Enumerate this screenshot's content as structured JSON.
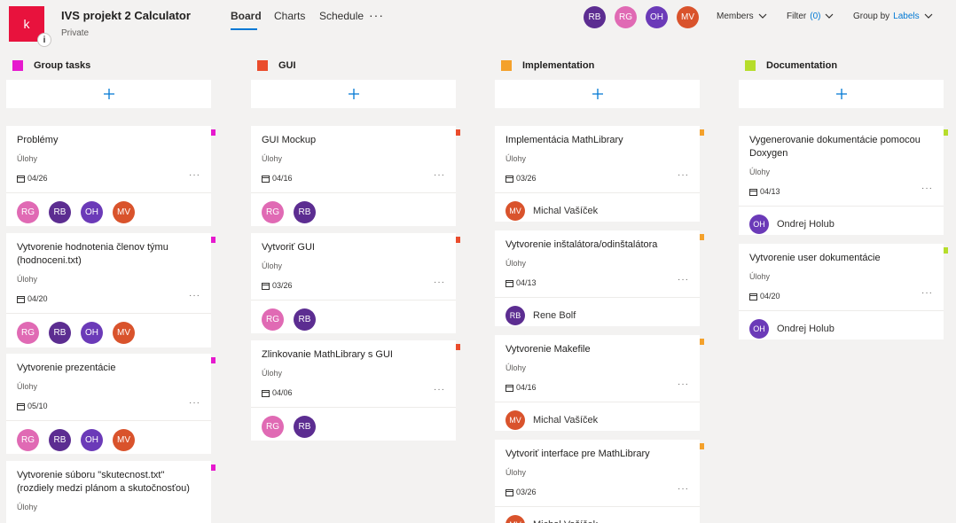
{
  "header": {
    "logo_letter": "k",
    "logo_badge": "i",
    "plan_title": "IVS projekt 2 Calculator",
    "plan_subtitle": "Private",
    "tabs": [
      {
        "label": "Board",
        "active": true
      },
      {
        "label": "Charts"
      },
      {
        "label": "Schedule"
      }
    ],
    "more_label": "···",
    "avatars": [
      {
        "initials": "RB",
        "color": "#5c2d91"
      },
      {
        "initials": "RG",
        "color": "#e06ab4"
      },
      {
        "initials": "OH",
        "color": "#6b3ab8"
      },
      {
        "initials": "MV",
        "color": "#d9532c"
      }
    ],
    "members_label": "Members",
    "filter_label": "Filter",
    "filter_count": "(0)",
    "group_by_label": "Group by",
    "group_by_value": "Labels"
  },
  "colors": {
    "accent": "#0078d4",
    "RB": "#5c2d91",
    "RG": "#e06ab4",
    "OH": "#6b3ab8",
    "MV": "#d9532c",
    "pink": "#e619ce",
    "red": "#ea4c2c",
    "orange": "#f4a12b",
    "lime": "#b6dd2b"
  },
  "columns": [
    {
      "name": "Group tasks",
      "color": "#e619ce",
      "cards": [
        {
          "title": "Problémy",
          "bucket": "Úlohy",
          "date": "04/26",
          "avatars": [
            "RG",
            "RB",
            "OH",
            "MV"
          ]
        },
        {
          "title": "Vytvorenie hodnotenia členov týmu (hodnoceni.txt)",
          "bucket": "Úlohy",
          "date": "04/20",
          "avatars": [
            "RG",
            "RB",
            "OH",
            "MV"
          ]
        },
        {
          "title": "Vytvorenie prezentácie",
          "bucket": "Úlohy",
          "date": "05/10",
          "avatars": [
            "RG",
            "RB",
            "OH",
            "MV"
          ]
        },
        {
          "title": "Vytvorenie súboru \"skutecnost.txt\" (rozdiely medzi plánom a skutočnosťou)",
          "bucket": "Úlohy"
        }
      ]
    },
    {
      "name": "GUI",
      "color": "#ea4c2c",
      "cards": [
        {
          "title": "GUI Mockup",
          "bucket": "Úlohy",
          "date": "04/16",
          "avatars": [
            "RG",
            "RB"
          ]
        },
        {
          "title": "Vytvoriť GUI",
          "bucket": "Úlohy",
          "date": "03/26",
          "avatars": [
            "RG",
            "RB"
          ]
        },
        {
          "title": "Zlinkovanie MathLibrary s GUI",
          "bucket": "Úlohy",
          "date": "04/06",
          "avatars": [
            "RG",
            "RB"
          ]
        }
      ]
    },
    {
      "name": "Implementation",
      "color": "#f4a12b",
      "cards": [
        {
          "title": "Implementácia MathLibrary",
          "bucket": "Úlohy",
          "date": "03/26",
          "assignee": {
            "initials": "MV",
            "name": "Michal Vašíček"
          }
        },
        {
          "title": "Vytvorenie inštalátora/odinštalátora",
          "bucket": "Úlohy",
          "date": "04/13",
          "assignee": {
            "initials": "RB",
            "name": "Rene Bolf"
          }
        },
        {
          "title": "Vytvorenie Makefile",
          "bucket": "Úlohy",
          "date": "04/16",
          "assignee": {
            "initials": "MV",
            "name": "Michal Vašíček"
          }
        },
        {
          "title": "Vytvoriť interface pre MathLibrary",
          "bucket": "Úlohy",
          "date": "03/26",
          "assignee": {
            "initials": "MV",
            "name": "Michal Vašíček"
          }
        }
      ]
    },
    {
      "name": "Documentation",
      "color": "#b6dd2b",
      "cards": [
        {
          "title": "Vygenerovanie dokumentácie pomocou Doxygen",
          "bucket": "Úlohy",
          "date": "04/13",
          "assignee": {
            "initials": "OH",
            "name": "Ondrej Holub"
          }
        },
        {
          "title": "Vytvorenie user dokumentácie",
          "bucket": "Úlohy",
          "date": "04/20",
          "assignee": {
            "initials": "OH",
            "name": "Ondrej Holub"
          }
        }
      ]
    }
  ]
}
